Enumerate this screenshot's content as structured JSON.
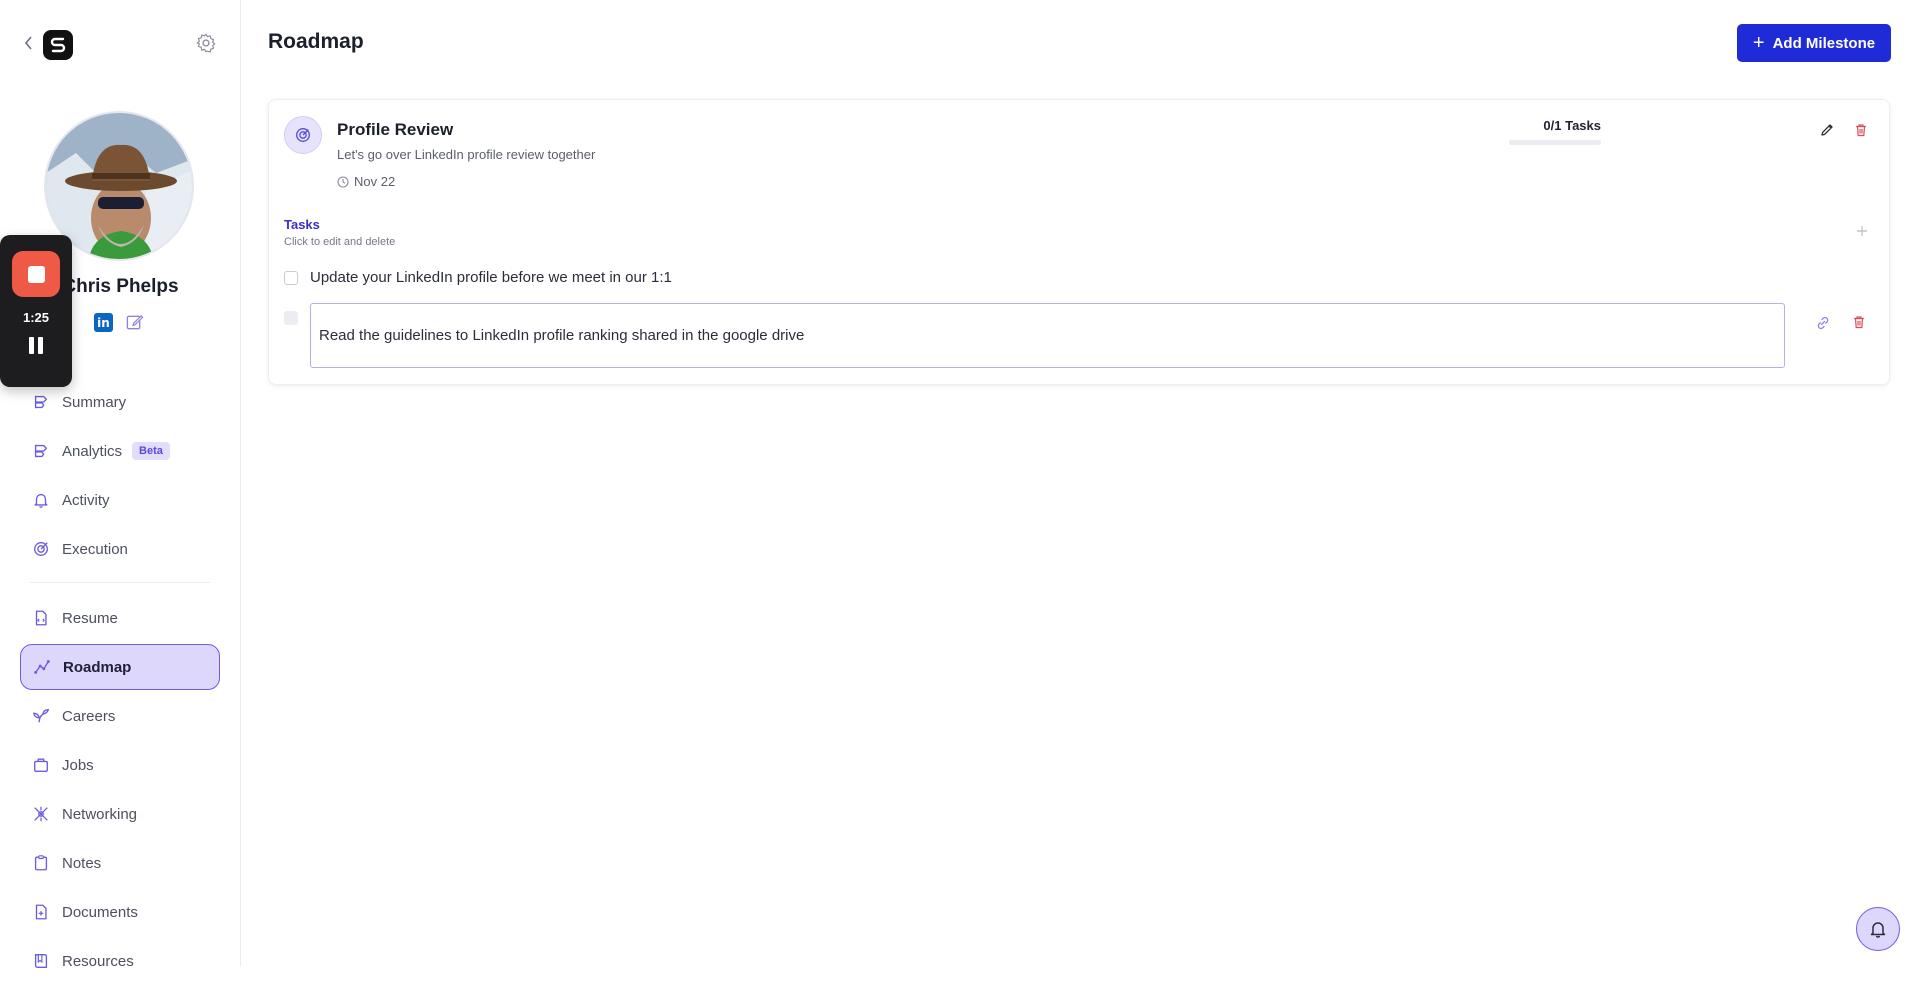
{
  "sidebar": {
    "profile": {
      "name": "Chris Phelps"
    },
    "social": {
      "linkedin_text": "in"
    },
    "nav": [
      {
        "label": "Summary",
        "icon": "summary-icon"
      },
      {
        "label": "Analytics",
        "icon": "analytics-icon",
        "badge": "Beta"
      },
      {
        "label": "Activity",
        "icon": "bell-icon"
      },
      {
        "label": "Execution",
        "icon": "target-icon"
      },
      {
        "label": "Resume",
        "icon": "resume-icon"
      },
      {
        "label": "Roadmap",
        "icon": "roadmap-icon",
        "active": true
      },
      {
        "label": "Careers",
        "icon": "sprout-icon"
      },
      {
        "label": "Jobs",
        "icon": "briefcase-icon"
      },
      {
        "label": "Networking",
        "icon": "network-icon"
      },
      {
        "label": "Notes",
        "icon": "clipboard-icon"
      },
      {
        "label": "Documents",
        "icon": "document-icon"
      },
      {
        "label": "Resources",
        "icon": "book-icon"
      }
    ]
  },
  "recorder": {
    "elapsed": "1:25"
  },
  "header": {
    "title": "Roadmap",
    "add_button_label": "Add Milestone"
  },
  "milestone": {
    "title": "Profile Review",
    "description": "Let's go over LinkedIn profile review together",
    "date": "Nov 22",
    "progress_label": "0/1 Tasks",
    "progress_fraction": 0,
    "tasks_heading": "Tasks",
    "tasks_hint": "Click to edit and delete",
    "tasks": [
      {
        "text": "Update your LinkedIn profile before we meet in our 1:1",
        "done": false
      },
      {
        "text": "Read the guidelines to LinkedIn profile ranking shared in the google drive",
        "done": false,
        "editing": true
      }
    ]
  },
  "colors": {
    "accent": "#1f2bd6",
    "active_nav_bg": "#ddd7fb",
    "active_nav_border": "#6c5ce7",
    "delete": "#e24b5a",
    "recorder_stop": "#ef5a47"
  }
}
